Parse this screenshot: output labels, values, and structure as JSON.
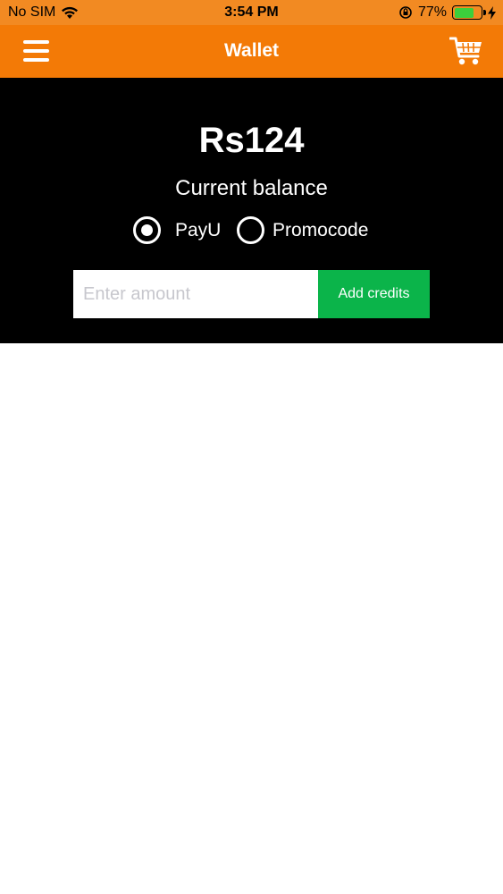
{
  "status_bar": {
    "carrier": "No SIM",
    "time": "3:54 PM",
    "battery_percent": "77%",
    "battery_level": 0.77,
    "icons": [
      "wifi-icon",
      "orientation-lock-icon",
      "battery-icon",
      "charging-bolt-icon"
    ]
  },
  "nav": {
    "title": "Wallet",
    "left_icon": "hamburger-menu-icon",
    "right_icon": "shopping-cart-icon"
  },
  "wallet": {
    "balance": "Rs124",
    "balance_label": "Current balance",
    "payment_options": [
      {
        "label": "PayU",
        "selected": true
      },
      {
        "label": "Promocode",
        "selected": false
      }
    ],
    "amount_placeholder": "Enter amount",
    "amount_value": "",
    "add_credits_label": "Add credits"
  },
  "colors": {
    "status_bar_bg": "#f28a22",
    "nav_bg": "#f37a06",
    "panel_bg": "#000000",
    "button_green": "#0bb44a",
    "battery_green": "#3ccf3c"
  }
}
